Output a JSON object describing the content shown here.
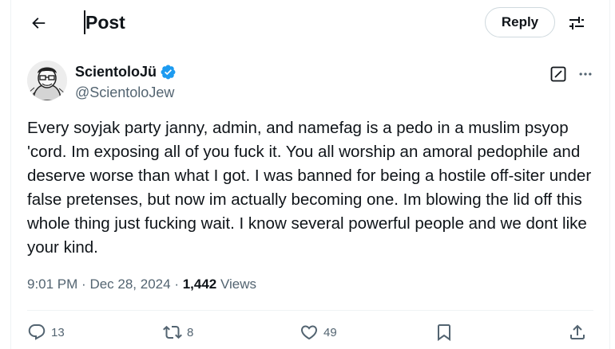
{
  "header": {
    "title": "Post",
    "reply_label": "Reply"
  },
  "author": {
    "display_name": "ScientoloJü",
    "handle": "@ScientoloJew",
    "verified": true
  },
  "tweet": {
    "text": "Every soyjak party janny, admin, and namefag is a pedo in a muslim psyop 'cord. Im exposing all of you fuck it. You all worship an amoral pedophile and deserve worse than what I got. I was banned for being a hostile off-siter under false pretenses, but now im actually becoming one. Im blowing the lid off this whole thing just fucking wait. I know several powerful people and we dont like your kind.",
    "time": "9:01 PM",
    "date": "Dec 28, 2024",
    "views_count": "1,442",
    "views_label": "Views"
  },
  "actions": {
    "replies": "13",
    "reposts": "8",
    "likes": "49"
  },
  "icons": {
    "back": "arrow-left-icon",
    "settings": "sliders-icon",
    "verified": "verified-badge-icon",
    "grok": "grok-icon",
    "more": "more-horizontal-icon",
    "reply": "reply-icon",
    "repost": "repost-icon",
    "like": "heart-icon",
    "bookmark": "bookmark-icon",
    "share": "share-icon"
  },
  "colors": {
    "verified": "#1d9bf0",
    "secondary_text": "#536471",
    "primary_text": "#0f1419"
  }
}
